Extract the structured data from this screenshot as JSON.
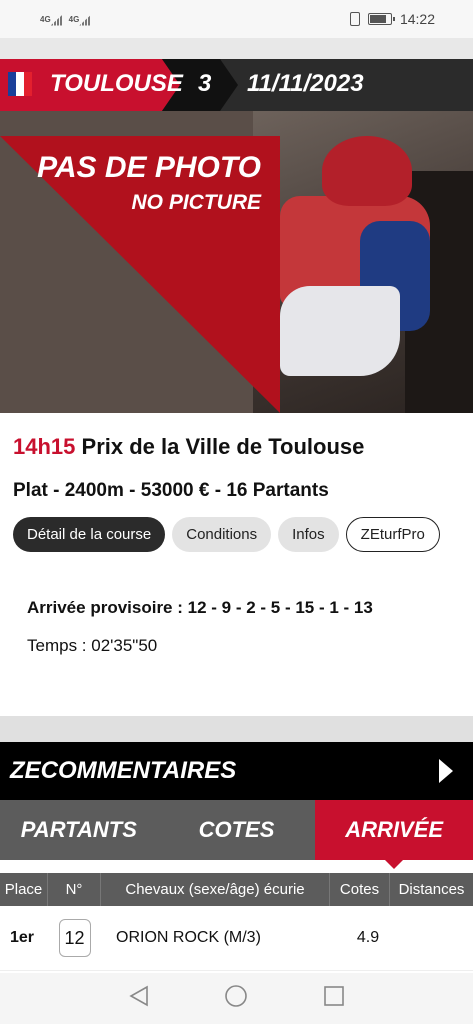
{
  "status": {
    "signal1": "4G",
    "signal2": "4G",
    "time": "14:22"
  },
  "header": {
    "venue": "TOULOUSE",
    "race_number": "3",
    "date": "11/11/2023"
  },
  "photo": {
    "line1": "PAS DE PHOTO",
    "line2": "NO PICTURE"
  },
  "race": {
    "time": "14h15",
    "name": "Prix de la Ville de Toulouse",
    "details": "Plat - 2400m - 53000 € - 16 Partants"
  },
  "pills": [
    "Détail de la course",
    "Conditions",
    "Infos",
    "ZEturfPro"
  ],
  "result": {
    "arrivee": "Arrivée provisoire : 12 - 9 - 2 - 5 - 15 - 1 - 13",
    "temps": "Temps : 02'35\"50"
  },
  "zecommentaires": "ZECOMMENTAIRES",
  "tabs": [
    "PARTANTS",
    "COTES",
    "ARRIVÉE"
  ],
  "table": {
    "headers": [
      "Place",
      "N°",
      "Chevaux (sexe/âge) écurie",
      "Cotes",
      "Distances"
    ],
    "rows": [
      {
        "place": "1er",
        "num": "12",
        "horse": "ORION ROCK (M/3)",
        "cote": "4.9",
        "distance": ""
      }
    ]
  },
  "colors": {
    "accent": "#c8102e",
    "dark": "#2b2b2b",
    "tabs": "#5c5c5c"
  }
}
